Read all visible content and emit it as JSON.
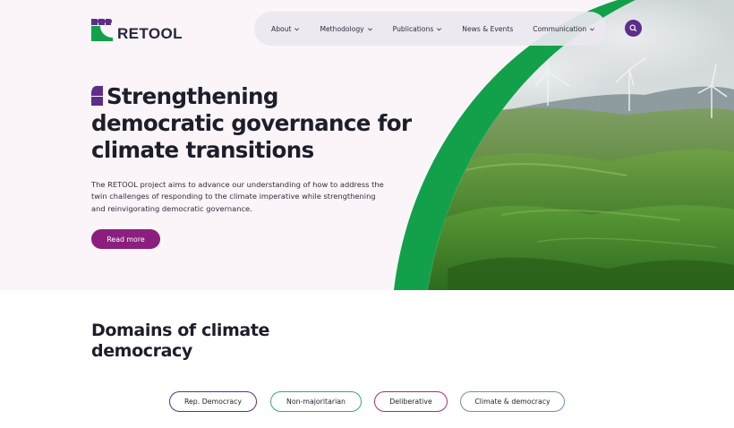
{
  "brand": {
    "name": "RETOOL",
    "mark_icon": "retool-logo-mark-icon",
    "colors": {
      "green": "#12a14a",
      "purple": "#5c2e8a",
      "magenta": "#8b1f7e"
    }
  },
  "nav": {
    "items": [
      {
        "label": "About",
        "has_dropdown": true
      },
      {
        "label": "Methodology",
        "has_dropdown": true
      },
      {
        "label": "Publications",
        "has_dropdown": true
      },
      {
        "label": "News & Events",
        "has_dropdown": false
      },
      {
        "label": "Communication",
        "has_dropdown": true
      }
    ],
    "search_icon": "search-icon"
  },
  "hero": {
    "title": "Strengthening democratic governance for climate transitions",
    "description": "The RETOOL project aims to advance our understanding of how to address the twin challenges of responding to the climate imperative while strengthening and reinvigorating democratic governance.",
    "cta_label": "Read more",
    "image": "green-hills-wind-turbines"
  },
  "domains": {
    "title": "Domains of climate democracy",
    "pills": [
      {
        "label": "Rep. Democracy",
        "border_color": "#5c2e8a"
      },
      {
        "label": "Non-majoritarian",
        "border_color": "#3aa57a"
      },
      {
        "label": "Deliberative",
        "border_color": "#a0307e"
      },
      {
        "label": "Climate & democracy",
        "border_color": "#6a90b8"
      }
    ]
  }
}
